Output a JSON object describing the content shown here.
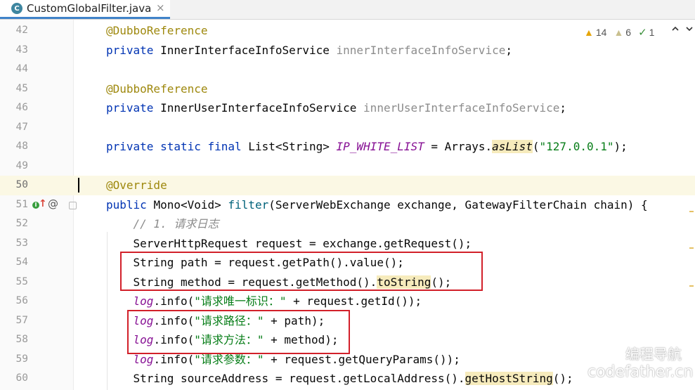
{
  "tab": {
    "icon_letter": "C",
    "title": "CustomGlobalFilter.java",
    "close_glyph": "×"
  },
  "inspection": {
    "warnings": "14",
    "weak_warnings": "6",
    "typos": "1",
    "prev_glyph": "⌃",
    "next_glyph": "⌄"
  },
  "gutter": {
    "at_glyph": "@",
    "up_glyph": "↑"
  },
  "lines": [
    {
      "num": "42",
      "segments": [
        [
          "ann",
          "@DubboReference"
        ]
      ]
    },
    {
      "num": "43",
      "segments": [
        [
          "kw",
          "private "
        ],
        [
          "",
          "InnerInterfaceInfoService "
        ],
        [
          "unused",
          "innerInterfaceInfoService"
        ],
        [
          "",
          ";"
        ]
      ]
    },
    {
      "num": "44",
      "segments": []
    },
    {
      "num": "45",
      "segments": [
        [
          "ann",
          "@DubboReference"
        ]
      ]
    },
    {
      "num": "46",
      "segments": [
        [
          "kw",
          "private "
        ],
        [
          "",
          "InnerUserInterfaceInfoService "
        ],
        [
          "unused",
          "innerUserInterfaceInfoService"
        ],
        [
          "",
          ";"
        ]
      ]
    },
    {
      "num": "47",
      "segments": []
    },
    {
      "num": "48",
      "segments": [
        [
          "kw",
          "private static final "
        ],
        [
          "",
          "List<String> "
        ],
        [
          "fld",
          "IP_WHITE_LIST"
        ],
        [
          "",
          " = Arrays."
        ],
        [
          "sm hl",
          "asList"
        ],
        [
          "",
          "("
        ],
        [
          "str",
          "\"127.0.0.1\""
        ],
        [
          "",
          ");"
        ]
      ]
    },
    {
      "num": "49",
      "segments": []
    },
    {
      "num": "50",
      "segments": [
        [
          "ann",
          "@Override"
        ]
      ]
    },
    {
      "num": "51",
      "segments": [
        [
          "kw",
          "public "
        ],
        [
          "",
          "Mono<Void> "
        ],
        [
          "mth",
          "filter"
        ],
        [
          "",
          "(ServerWebExchange exchange, GatewayFilterChain chain) {"
        ]
      ]
    },
    {
      "num": "52",
      "segments": [
        [
          "cmt",
          "    // 1. 请求日志"
        ]
      ]
    },
    {
      "num": "53",
      "segments": [
        [
          "",
          "    ServerHttpRequest request = exchange.getRequest();"
        ]
      ]
    },
    {
      "num": "54",
      "segments": [
        [
          "",
          "    String path = request.getPath().value();"
        ]
      ]
    },
    {
      "num": "55",
      "segments": [
        [
          "",
          "    String method = request.getMethod()."
        ],
        [
          "hl",
          "toString"
        ],
        [
          "",
          "();"
        ]
      ]
    },
    {
      "num": "56",
      "segments": [
        [
          "",
          "    "
        ],
        [
          "fld",
          "log"
        ],
        [
          "",
          ".info("
        ],
        [
          "str",
          "\"请求唯一标识：\""
        ],
        [
          "",
          " + request.getId());"
        ]
      ]
    },
    {
      "num": "57",
      "segments": [
        [
          "",
          "    "
        ],
        [
          "fld",
          "log"
        ],
        [
          "",
          ".info("
        ],
        [
          "str",
          "\"请求路径：\""
        ],
        [
          "",
          " + path);"
        ]
      ]
    },
    {
      "num": "58",
      "segments": [
        [
          "",
          "    "
        ],
        [
          "fld",
          "log"
        ],
        [
          "",
          ".info("
        ],
        [
          "str",
          "\"请求方法：\""
        ],
        [
          "",
          " + method);"
        ]
      ]
    },
    {
      "num": "59",
      "segments": [
        [
          "",
          "    "
        ],
        [
          "fld",
          "log"
        ],
        [
          "",
          ".info("
        ],
        [
          "str",
          "\"请求参数：\""
        ],
        [
          "",
          " + request.getQueryParams());"
        ]
      ]
    },
    {
      "num": "60",
      "segments": [
        [
          "",
          "    String sourceAddress = request.getLocalAddress()."
        ],
        [
          "hl",
          "getHostString"
        ],
        [
          "",
          "();"
        ]
      ]
    }
  ],
  "watermark": {
    "line1": "编程导航",
    "line2": "codefather.cn"
  },
  "colors": {
    "keyword": "#0033b3",
    "annotation": "#9e880d",
    "string": "#067d17",
    "field": "#871094",
    "highlight_box": "#d2202a"
  }
}
